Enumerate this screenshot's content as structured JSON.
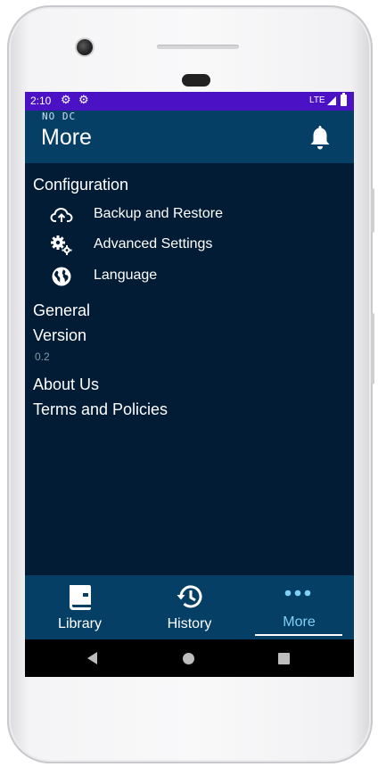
{
  "status_bar": {
    "time": "2:10",
    "network": "LTE",
    "notification_icons": [
      "gear-icon",
      "gear-icon"
    ]
  },
  "app_bar": {
    "build_tag": "NO DC",
    "title": "More",
    "action_icon": "bell-icon"
  },
  "configuration": {
    "heading": "Configuration",
    "items": [
      {
        "label": "Backup and Restore",
        "icon": "cloud-upload-icon"
      },
      {
        "label": "Advanced Settings",
        "icon": "gears-icon"
      },
      {
        "label": "Language",
        "icon": "globe-icon"
      }
    ]
  },
  "general": {
    "heading": "General",
    "version_label": "Version",
    "version_value": "0.2",
    "about_label": "About Us",
    "terms_label": "Terms and Policies"
  },
  "bottom_nav": {
    "items": [
      {
        "label": "Library",
        "icon": "book-icon",
        "active": false
      },
      {
        "label": "History",
        "icon": "history-icon",
        "active": false
      },
      {
        "label": "More",
        "icon": "dots-icon",
        "active": true
      }
    ]
  },
  "colors": {
    "status_bar": "#4a12c4",
    "app_bar": "#053f65",
    "background": "#011c34",
    "active_nav": "#7fd0f7"
  }
}
